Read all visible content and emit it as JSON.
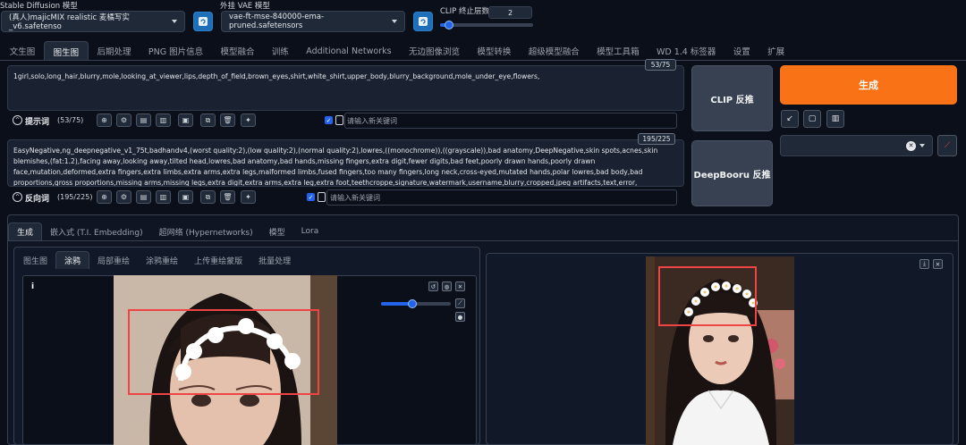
{
  "header": {
    "sd_model_label": "Stable Diffusion 模型",
    "sd_model_value": "(真人)majicMIX realistic 麦橘写实_v6.safetenso",
    "vae_label": "外挂 VAE 模型",
    "vae_value": "vae-ft-mse-840000-ema-pruned.safetensors",
    "clip_label": "CLIP 终止层数",
    "clip_value": "2",
    "clip_slider_fraction": 0.1
  },
  "main_tabs": [
    "文生图",
    "图生图",
    "后期处理",
    "PNG 图片信息",
    "模型融合",
    "训练",
    "Additional Networks",
    "无边图像浏览",
    "模型转换",
    "超级模型融合",
    "模型工具箱",
    "WD 1.4 标签器",
    "设置",
    "扩展"
  ],
  "main_tab_active": 1,
  "prompt": {
    "text": "1girl,solo,long_hair,blurry,mole,looking_at_viewer,lips,depth_of_field,brown_eyes,shirt,white_shirt,upper_body,blurry_background,mole_under_eye,flowers,",
    "counter": "53/75",
    "toolbar_label": "提示词",
    "toolbar_count": "(53/75)",
    "keyword_placeholder": "请输入新关键词"
  },
  "negative": {
    "text": "EasyNegative,ng_deepnegative_v1_75t,badhandv4,(worst quality:2),(low quality:2),(normal quality:2),lowres,((monochrome)),((grayscale)),bad anatomy,DeepNegative,skin spots,acnes,skin blemishes,(fat:1.2),facing away,looking away,tilted head,lowres,bad anatomy,bad hands,missing fingers,extra digit,fewer digits,bad feet,poorly drawn hands,poorly drawn face,mutation,deformed,extra fingers,extra limbs,extra arms,extra legs,malformed limbs,fused fingers,too many fingers,long neck,cross-eyed,mutated hands,polar lowres,bad body,bad proportions,gross proportions,missing arms,missing legs,extra digit,extra arms,extra leg,extra foot,teethcroppe,signature,watermark,username,blurry,cropped,jpeg artifacts,text,error,",
    "counter": "195/225",
    "toolbar_label": "反向词",
    "toolbar_count": "(195/225)",
    "keyword_placeholder": "请输入新关键词"
  },
  "buttons": {
    "clip_interrogate": "CLIP 反推",
    "deepbooru_interrogate": "DeepBooru 反推",
    "generate": "生成"
  },
  "colors": {
    "generate": "#f97316",
    "highlight_box": "#ef4444",
    "accent": "#2563eb"
  },
  "sub_tabs": [
    "生成",
    "嵌入式 (T.I. Embedding)",
    "超网络 (Hypernetworks)",
    "模型",
    "Lora"
  ],
  "sub_tab_active": 0,
  "img2img_tabs": [
    "图生图",
    "涂鸦",
    "局部重绘",
    "涂鸦重绘",
    "上传重绘蒙版",
    "批量处理"
  ],
  "img2img_tab_active": 1,
  "canvas": {
    "info_icon": "i",
    "brush_slider_fraction": 0.45
  }
}
